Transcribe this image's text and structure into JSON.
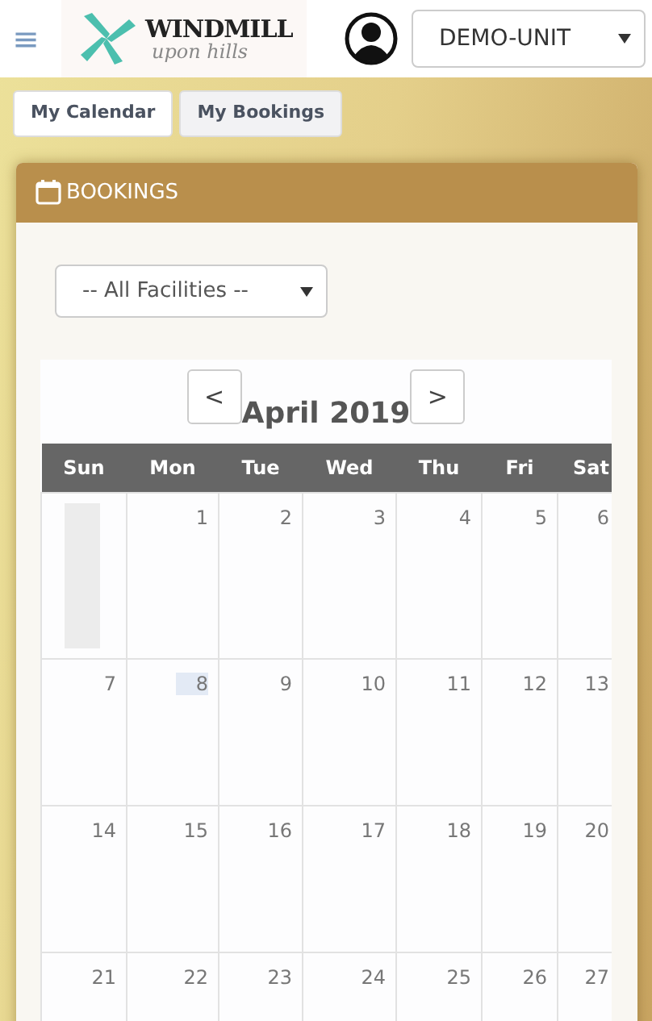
{
  "header": {
    "menu_icon": "≡",
    "logo": {
      "name": "WINDMILL",
      "tagline": "upon hills"
    },
    "unit_select": {
      "value": "DEMO-UNIT"
    }
  },
  "nav_buttons": [
    {
      "label": "My Calendar",
      "selected": false
    },
    {
      "label": "My Bookings",
      "selected": true
    }
  ],
  "bookings_card": {
    "title": "BOOKINGS",
    "facility_select": {
      "value": "-- All Facilities --"
    },
    "calendar": {
      "prev": "<",
      "next": ">",
      "month": "April 2019",
      "weekdays": [
        "Sun",
        "Mon",
        "Tue",
        "Wed",
        "Thu",
        "Fri",
        "Sat"
      ],
      "weeks": [
        [
          {
            "kind": "blank"
          },
          {
            "kind": "day",
            "number": "1",
            "today": false
          },
          {
            "kind": "day",
            "number": "2",
            "today": false
          },
          {
            "kind": "day",
            "number": "3",
            "today": false
          },
          {
            "kind": "day",
            "number": "4",
            "today": false
          },
          {
            "kind": "day",
            "number": "5",
            "today": false
          },
          {
            "kind": "day",
            "number": "6",
            "today": false
          }
        ],
        [
          {
            "kind": "day",
            "number": "7",
            "today": false
          },
          {
            "kind": "day",
            "number": "8",
            "today": true
          },
          {
            "kind": "day",
            "number": "9",
            "today": false
          },
          {
            "kind": "day",
            "number": "10",
            "today": false
          },
          {
            "kind": "day",
            "number": "11",
            "today": false
          },
          {
            "kind": "day",
            "number": "12",
            "today": false
          },
          {
            "kind": "day",
            "number": "13",
            "today": false
          }
        ],
        [
          {
            "kind": "day",
            "number": "14",
            "today": false
          },
          {
            "kind": "day",
            "number": "15",
            "today": false
          },
          {
            "kind": "day",
            "number": "16",
            "today": false
          },
          {
            "kind": "day",
            "number": "17",
            "today": false
          },
          {
            "kind": "day",
            "number": "18",
            "today": false
          },
          {
            "kind": "day",
            "number": "19",
            "today": false
          },
          {
            "kind": "day",
            "number": "20",
            "today": false
          }
        ],
        [
          {
            "kind": "day",
            "number": "21",
            "today": false
          },
          {
            "kind": "day",
            "number": "22",
            "today": false
          },
          {
            "kind": "day",
            "number": "23",
            "today": false
          },
          {
            "kind": "day",
            "number": "24",
            "today": false
          },
          {
            "kind": "day",
            "number": "25",
            "today": false
          },
          {
            "kind": "day",
            "number": "26",
            "today": false
          },
          {
            "kind": "day",
            "number": "27",
            "today": false
          }
        ]
      ]
    }
  }
}
